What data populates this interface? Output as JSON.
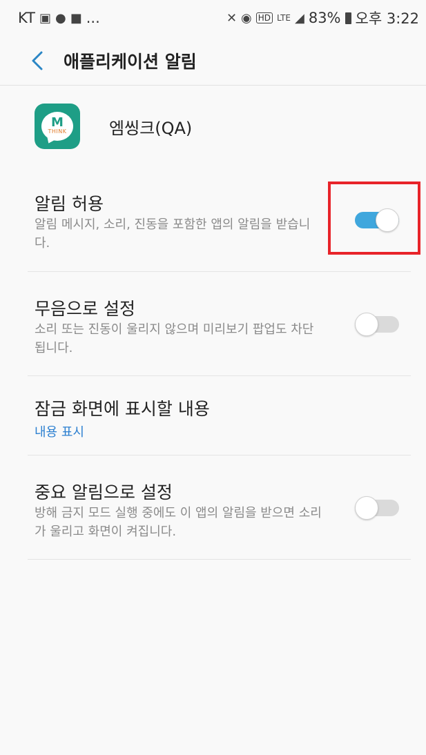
{
  "status_bar": {
    "carrier": "KT",
    "notification_icons": [
      "gallery-icon",
      "kakaotalk-icon",
      "message-icon"
    ],
    "more": "...",
    "battery": "83%",
    "time": "오후 3:22",
    "system_icons": [
      "mute-vibrate-icon",
      "alarm-icon",
      "hd-icon",
      "lte-icon",
      "signal-icon",
      "battery-icon"
    ]
  },
  "app_bar": {
    "title": "애플리케이션 알림"
  },
  "app": {
    "name": "엠씽크(QA)",
    "icon_letter": "M",
    "icon_text": "THINK"
  },
  "settings": [
    {
      "title": "알림 허용",
      "description": "알림 메시지, 소리, 진동을 포함한 앱의 알림을 받습니다.",
      "toggle": true
    },
    {
      "title": "무음으로 설정",
      "description": "소리 또는 진동이 울리지 않으며 미리보기 팝업도 차단됩니다.",
      "toggle": false
    },
    {
      "title": "잠금 화면에 표시할 내용",
      "value": "내용 표시"
    },
    {
      "title": "중요 알림으로 설정",
      "description": "방해 금지 모드 실행 중에도 이 앱의 알림을 받으면 소리가 울리고 화면이 켜집니다.",
      "toggle": false
    }
  ],
  "colors": {
    "accent": "#40a7dd",
    "link": "#2b7fd0",
    "highlight": "#e8242a",
    "app_icon": "#1e9e86"
  }
}
